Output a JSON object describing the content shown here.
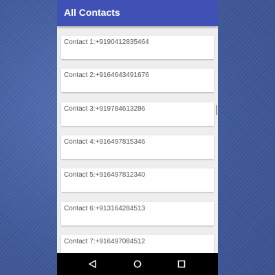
{
  "app_bar": {
    "title": "All Contacts"
  },
  "contacts": [
    {
      "label": "Contact 1:+9190412835464"
    },
    {
      "label": "Contact 2:+9164643491676"
    },
    {
      "label": "Contact 3:+919784613286"
    },
    {
      "label": "Contact 4:+916497815346"
    },
    {
      "label": "Contact 5:+916497812340"
    },
    {
      "label": "Contact 6:+913164284513"
    },
    {
      "label": "Contact 7:+916497084512"
    }
  ],
  "nav_bar": {
    "icons": [
      "back-icon",
      "home-icon",
      "recents-icon"
    ]
  },
  "colors": {
    "primary": "#3f51b5",
    "background": "#eeeeee",
    "card": "#ffffff",
    "text": "#555555",
    "nav": "#000000"
  }
}
